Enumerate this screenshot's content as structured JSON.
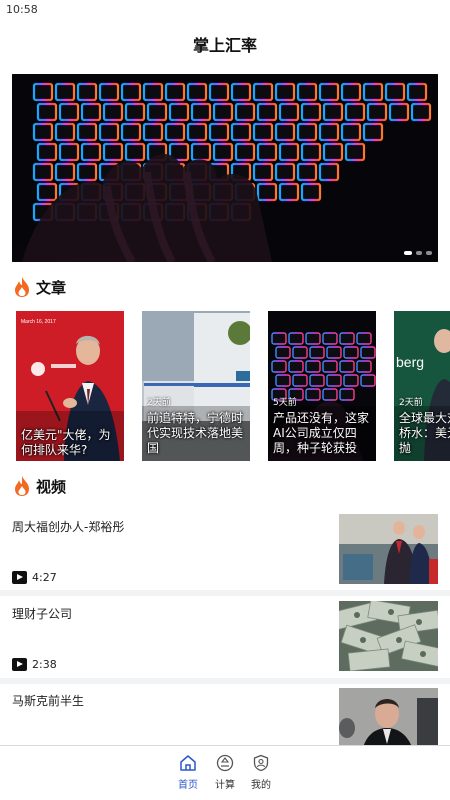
{
  "status_bar": {
    "time": "10:58"
  },
  "app": {
    "title": "掌上汇率"
  },
  "banner": {
    "dots": 3,
    "active_dot": 1
  },
  "sections": {
    "articles": {
      "label": "文章",
      "icon": "fire-icon"
    },
    "videos": {
      "label": "视频",
      "icon": "fire-icon"
    }
  },
  "articles": [
    {
      "title": "亿美元\"大佬，为何排队来华?",
      "age": "",
      "thumb_text": "March 16, 2017"
    },
    {
      "title": "前追特特，宁德时代实现技术落地美国",
      "age": "2天前",
      "thumb_text": ""
    },
    {
      "title": "产品还没有，这家AI公司成立仅四周，种子轮获投",
      "age": "5天前",
      "thumb_text": ""
    },
    {
      "title": "全球最大对冲基金桥水：美元利欧，抛",
      "age": "2天前",
      "thumb_text": "berg"
    }
  ],
  "videos": [
    {
      "title": "周大福创办人-郑裕彤",
      "duration": "4:27"
    },
    {
      "title": "理财子公司",
      "duration": "2:38"
    },
    {
      "title": "马斯克前半生",
      "duration": ""
    }
  ],
  "tabbar": {
    "tabs": [
      {
        "label": "首页",
        "icon": "home-icon",
        "active": true
      },
      {
        "label": "计算",
        "icon": "calculator-icon",
        "active": false
      },
      {
        "label": "我的",
        "icon": "profile-shield-icon",
        "active": false
      }
    ]
  },
  "colors": {
    "accent": "#2b58c9",
    "fire": "#f26a21",
    "separator": "#f2f3f5"
  }
}
